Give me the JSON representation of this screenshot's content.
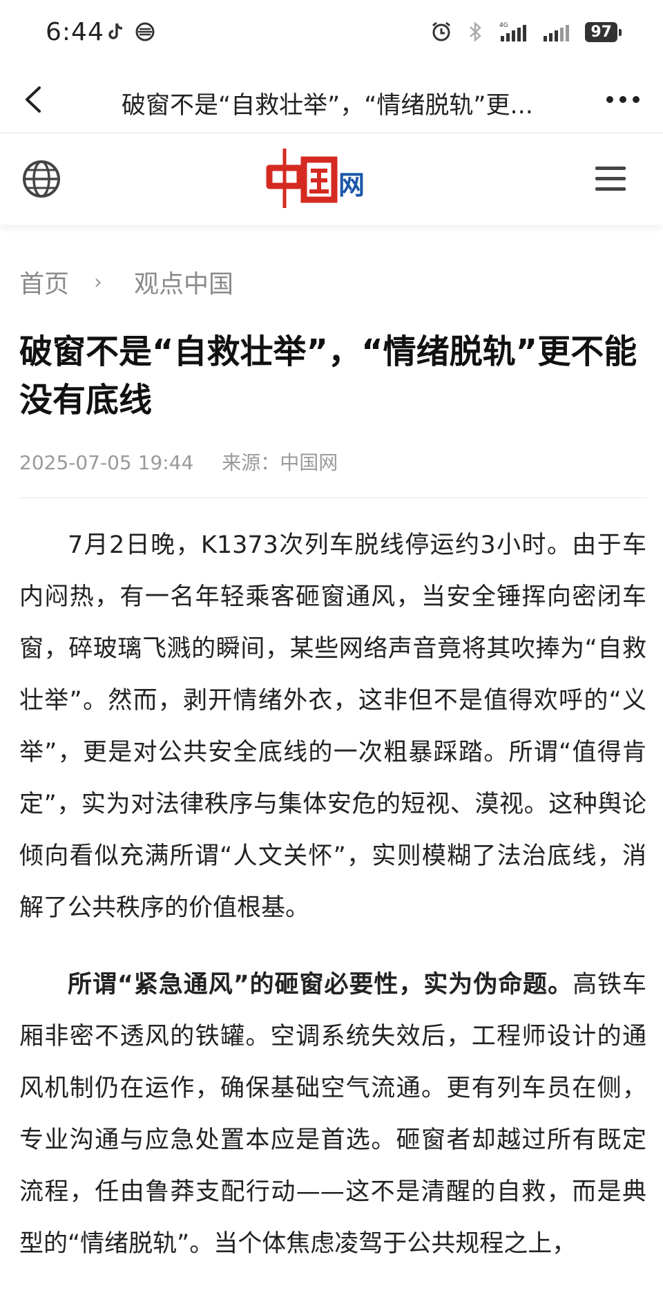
{
  "status_bar": {
    "time": "6:44",
    "battery": "97",
    "icons": [
      "tiktok-icon",
      "china-mobile-icon",
      "alarm-icon",
      "bluetooth-icon",
      "signal-4g-icon",
      "signal-icon"
    ]
  },
  "title_bar": {
    "heading": "破窗不是“自救壮举”，“情绪脱轨”更..."
  },
  "site_header": {
    "logo_text": "中国网",
    "accent_red": "#d42a21",
    "accent_blue": "#1a57a8"
  },
  "breadcrumb": {
    "home": "首页",
    "separator": "›",
    "section": "观点中国"
  },
  "article": {
    "title": "破窗不是“自救壮举”，“情绪脱轨”更不能没有底线",
    "date": "2025-07-05 19:44",
    "source_label": "来源：",
    "source": "中国网",
    "p1": "7月2日晚，K1373次列车脱线停运约3小时。由于车内闷热，有一名年轻乘客砸窗通风，当安全锤挥向密闭车窗，碎玻璃飞溅的瞬间，某些网络声音竟将其吹捧为“自救壮举”。然而，剥开情绪外衣，这非但不是值得欢呼的“义举”，更是对公共安全底线的一次粗暴踩踏。所谓“值得肯定”，实为对法律秩序与集体安危的短视、漠视。这种舆论倾向看似充满所谓“人文关怀”，实则模糊了法治底线，消解了公共秩序的价值根基。",
    "p2_bold": "所谓“紧急通风”的砸窗必要性，实为伪命题。",
    "p2": "高铁车厢非密不透风的铁罐。空调系统失效后，工程师设计的通风机制仍在运作，确保基础空气流通。更有列车员在侧，专业沟通与应急处置本应是首选。砸窗者却越过所有既定流程，任由鲁莽支配行动——这不是清醒的自救，而是典型的“情绪脱轨”。当个体焦虑凌驾于公共规程之上，"
  }
}
